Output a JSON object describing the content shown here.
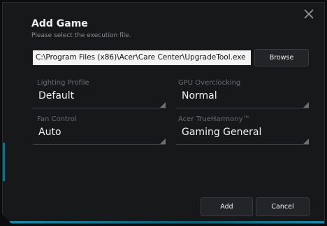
{
  "dialog": {
    "title": "Add Game",
    "subtitle": "Please select the execution file.",
    "path_value": "C:\\Program Files (x86)\\Acer\\Care Center\\UpgradeTool.exe",
    "browse_label": "Browse"
  },
  "fields": {
    "lighting_profile": {
      "label": "Lighting Profile",
      "value": "Default"
    },
    "gpu_overclocking": {
      "label": "GPU Overclocking",
      "value": "Normal"
    },
    "fan_control": {
      "label": "Fan Control",
      "value": "Auto"
    },
    "true_harmony": {
      "label": "Acer TrueHarmony™",
      "value": "Gaming General"
    }
  },
  "footer": {
    "add_label": "Add",
    "cancel_label": "Cancel"
  },
  "colors": {
    "background": "#17181a",
    "accent": "#0e8fb0",
    "label": "#6b6c70"
  },
  "icons": {
    "close": "close-icon",
    "dropdown": "dropdown-corner-icon"
  }
}
